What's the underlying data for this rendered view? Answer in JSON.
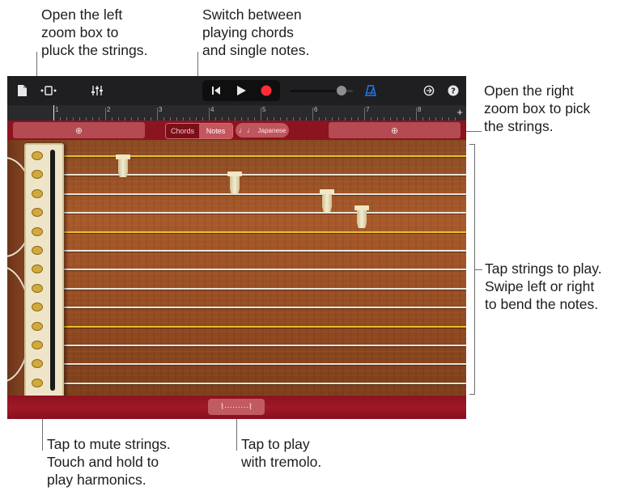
{
  "callouts": {
    "left_zoom": [
      "Open the left",
      "zoom box to",
      "pluck the strings."
    ],
    "switch_mode": [
      "Switch between",
      "playing chords",
      "and single notes."
    ],
    "right_zoom": [
      "Open the right",
      "zoom box to pick",
      "the strings."
    ],
    "tap_strings": [
      "Tap strings to play.",
      "Swipe left or right",
      "to bend the notes."
    ],
    "mute": [
      "Tap to mute strings.",
      "Touch and hold to",
      "play harmonics."
    ],
    "tremolo": [
      "Tap to play",
      "with tremolo."
    ]
  },
  "toolbar": {
    "browser_icon": "document-icon",
    "view_icon": "track-view-icon",
    "mixer_icon": "mixer-icon",
    "rewind_icon": "go-to-beginning-icon",
    "play_icon": "play-icon",
    "record_icon": "record-icon",
    "metronome_icon": "metronome-icon",
    "settings_icon": "settings-icon",
    "help_icon": "help-icon",
    "volume": 0.82,
    "add_symbol": "+"
  },
  "ruler": {
    "bars": [
      "1",
      "2",
      "3",
      "4",
      "5",
      "6",
      "7",
      "8"
    ]
  },
  "controls": {
    "zoom_symbol": "⊕",
    "chords_label": "Chords",
    "notes_label": "Notes",
    "scale_label": "Japanese",
    "scale_icon": "♩♩",
    "selected_mode": "Notes"
  },
  "instrument": {
    "string_count": 13,
    "gold_strings": [
      0,
      4,
      9
    ]
  },
  "tremolo": {
    "label": "⌇·········⌇"
  },
  "colors": {
    "accent": "#8b1420",
    "record": "#ff2d3c",
    "metronome": "#1e7cf5",
    "gold_string": "#e6c12e"
  }
}
